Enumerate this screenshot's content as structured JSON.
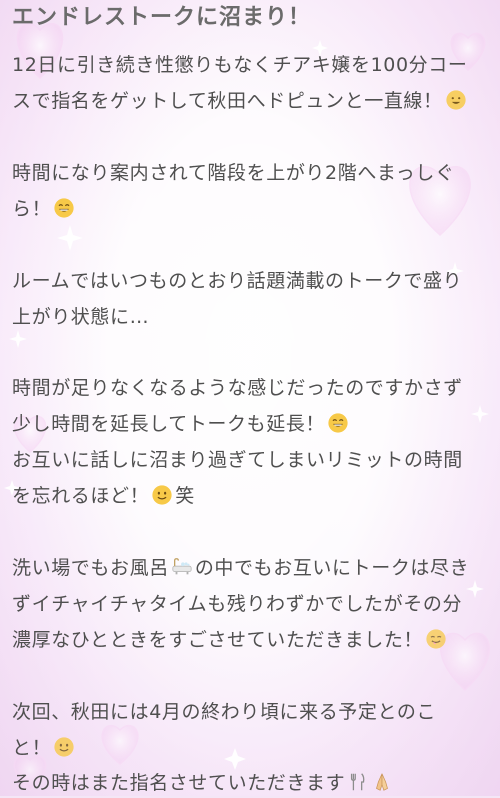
{
  "post": {
    "title": "エンドレストークに沼まり！",
    "lines": [
      {
        "text": "12日に引き続き性懲りもなくチアキ嬢を100分コー"
      },
      {
        "text": "スで指名をゲットして秋田へドピュンと一直線！",
        "emoji": "grinning-face-icon"
      },
      {
        "text": "時間になり案内されて階段を上がり2階へまっしぐ"
      },
      {
        "text": "ら！",
        "emoji": "grinning-face-icon"
      },
      {
        "text": "ルームではいつものとおり話題満載のトークで盛り"
      },
      {
        "text": "上がり状態に…"
      },
      {
        "text": "時間が足りなくなるような感じだったのですかさず"
      },
      {
        "text": "少し時間を延長してトークも延長！",
        "emoji": "grinning-face-icon"
      },
      {
        "text": "お互いに話しに沼まり過ぎてしまいリミットの時間"
      },
      {
        "text": "を忘れるほど！",
        "emoji": "slightly-smiling-face-icon",
        "text_after": "笑"
      },
      {
        "text": "洗い場でもお風呂",
        "emoji": "bathtub-icon",
        "text_after": "の中でもお互いにトークは尽き"
      },
      {
        "text": "ずイチャイチャタイムも残りわずかでしたがその分"
      },
      {
        "text": "濃厚なひとときをすごさせていただきました！",
        "emoji": "drooling-face-icon"
      },
      {
        "text": "次回、秋田には4月の終わり頃に来る予定とのこ"
      },
      {
        "text": "と！",
        "emoji": "slightly-smiling-face-icon"
      },
      {
        "text": "その時はまた指名させていただきます",
        "emoji": "fork-and-knife-icon",
        "emoji2": "folded-hands-icon"
      }
    ]
  },
  "colors": {
    "background": "#f4e6f6",
    "text": "#4f4f4f",
    "title": "#6b6b6b",
    "emoji_yellow": "#f7c948"
  }
}
